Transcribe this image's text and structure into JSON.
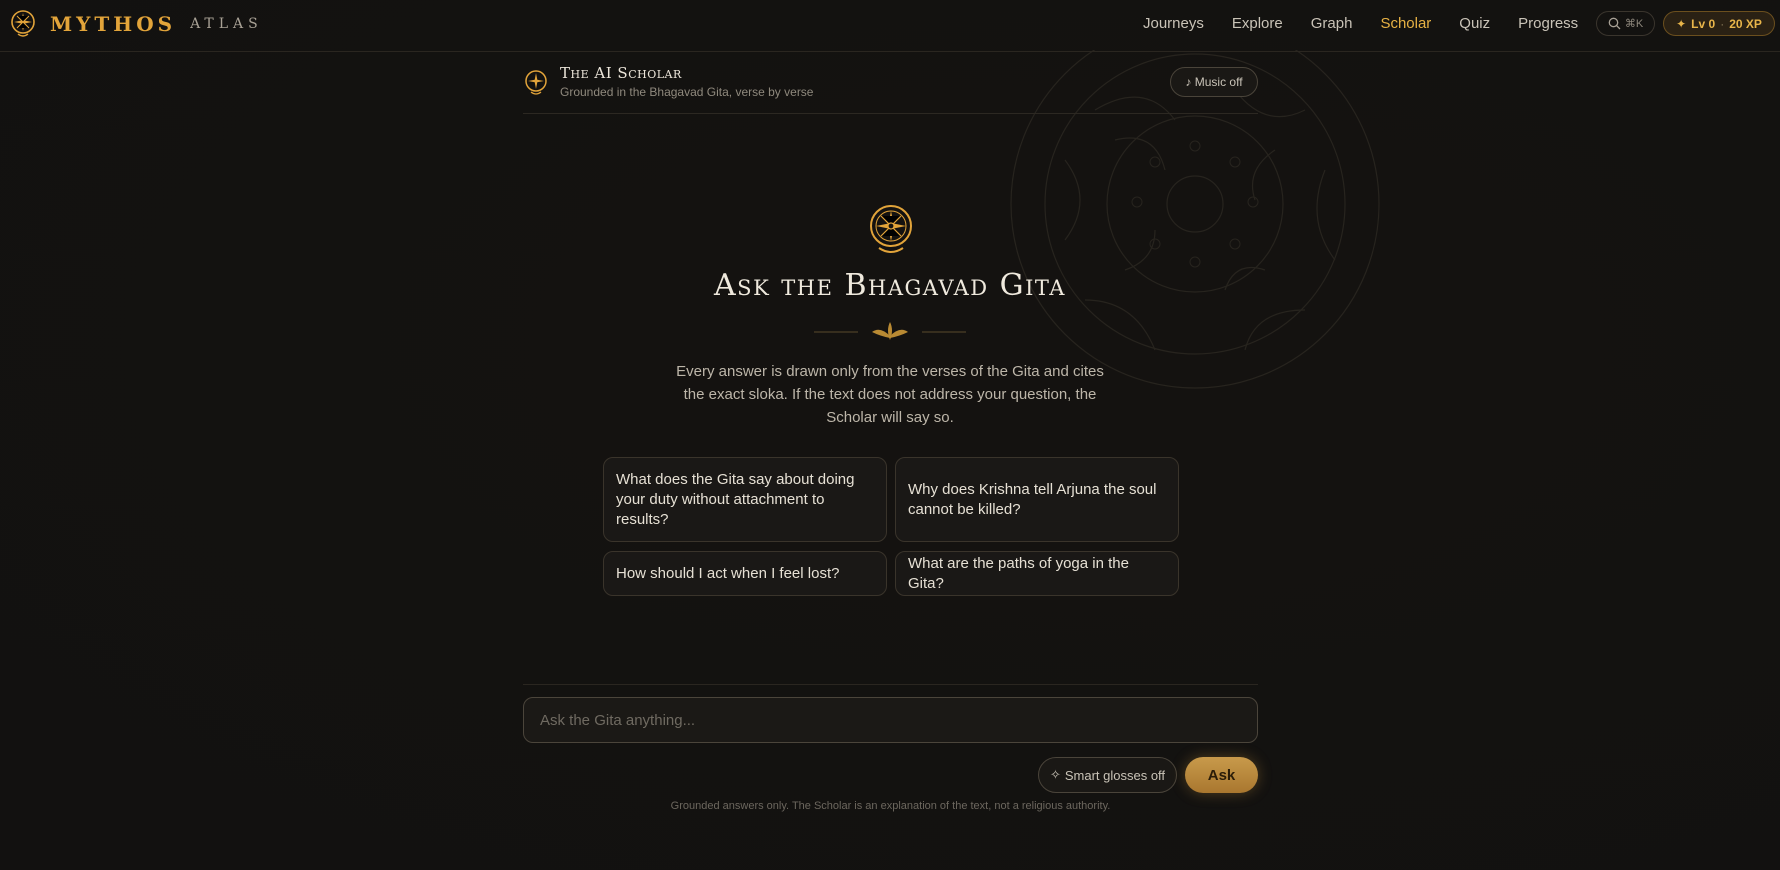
{
  "brand": {
    "name": "MYTHOS",
    "sub": "ATLAS",
    "logo_icon": "sun-emblem-icon"
  },
  "nav": {
    "items": [
      {
        "label": "Journeys",
        "active": false
      },
      {
        "label": "Explore",
        "active": false
      },
      {
        "label": "Graph",
        "active": false
      },
      {
        "label": "Scholar",
        "active": true
      },
      {
        "label": "Quiz",
        "active": false
      },
      {
        "label": "Progress",
        "active": false
      }
    ],
    "search_shortcut": "⌘K",
    "level": "Lv 0",
    "xp": "20 XP"
  },
  "scholar": {
    "title": "The AI Scholar",
    "subtitle": "Grounded in the Bhagavad Gita, verse by verse",
    "music_label": "♪ Music off"
  },
  "hero": {
    "title": "Ask the Bhagavad Gita",
    "intro": "Every answer is drawn only from the verses of the Gita and cites the exact sloka. If the text does not address your question, the Scholar will say so."
  },
  "suggestions": [
    "What does the Gita say about doing your duty without attachment to results?",
    "Why does Krishna tell Arjuna the soul cannot be killed?",
    "How should I act when I feel lost?",
    "What are the paths of yoga in the Gita?"
  ],
  "composer": {
    "placeholder": "Ask the Gita anything...",
    "gloss_label": "Smart glosses off",
    "ask_label": "Ask",
    "disclaimer": "Grounded answers only. The Scholar is an explanation of the text, not a religious authority."
  },
  "colors": {
    "accent": "#e2a43a",
    "background": "#141210"
  }
}
